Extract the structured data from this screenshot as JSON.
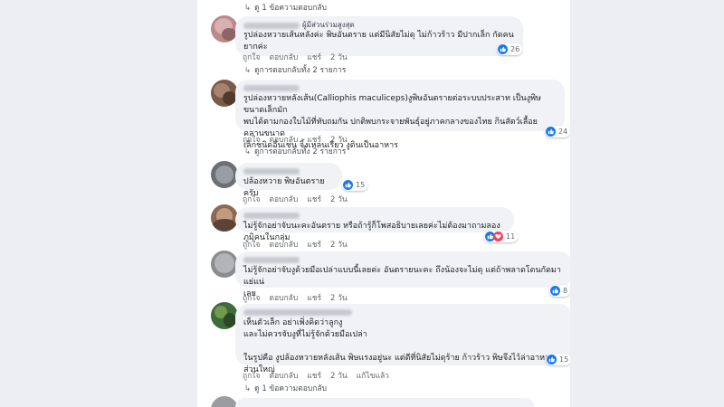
{
  "top_reply": {
    "text": "ดู 1 ข้อความตอบกลับ"
  },
  "comments": [
    {
      "badge": "ผู้มีส่วนร่วมสูงสุด",
      "text": "รูปล่องหวายเส้นหลังค่ะ พิษอันตราย แต่มีนิสัยไม่ดุ ไม่ก้าวร้าว มีปากเล็ก กัดคนยากค่ะ",
      "actions": [
        "ถูกใจ",
        "ตอบกลับ",
        "แชร์",
        "2 วัน"
      ],
      "reactions": "26",
      "replies": "ดูการตอบกลับทั้ง 2 รายการ"
    },
    {
      "badge": "",
      "text": "รูปล่องหวายหลังเส้น(Calliophis maculiceps)งูพิษอันตรายต่อระบบประสาท เป็นงูพิษขนาดเล็กมัก\nพบได้ตามกองใบไม้ที่ทับถมกัน ปกติพบกระจายพันธุ์อยู่ภาคกลางของไทย กินสัตว์เลื้อยคลานขนาด\nเล็กชนิดอื่นเช่น จิ้งเหลนเรียว งูดินเป็นอาหาร",
      "actions": [
        "ถูกใจ",
        "ตอบกลับ",
        "แชร์",
        "2 วัน"
      ],
      "reactions": "24",
      "replies": "ดูการตอบกลับทั้ง 2 รายการ"
    },
    {
      "badge": "",
      "text": "ปล้องหวาย พิษอันตรายครับ",
      "actions": [
        "ถูกใจ",
        "ตอบกลับ",
        "แชร์",
        "2 วัน"
      ],
      "reactions": "15"
    },
    {
      "badge": "",
      "text": "ไม่รู้จักอย่าจับนะคะอันตราย หรือถ้ารู้ก็โพสอธิบายเลยค่ะไม่ต้องมาถามลองภูมิคนในกลุ่ม",
      "actions": [
        "ถูกใจ",
        "ตอบกลับ",
        "แชร์",
        "2 วัน"
      ],
      "reactions": "11"
    },
    {
      "badge": "",
      "text": "ไม่รู้จักอย่าจับงูด้วยมือเปล่าแบบนี้เลยค่ะ อันตรายนะคะ ถึงน้องจะไม่ดุ แต่ถ้าพลาดโดนกัดมาแย่แน่\nเลย",
      "actions": [
        "ถูกใจ",
        "ตอบกลับ",
        "แชร์",
        "2 วัน"
      ],
      "reactions": "8"
    },
    {
      "badge": "",
      "text": "เห็นตัวเล็ก อย่าเพิ่งคิดว่าลูกงู\nและไม่ควรจับงูที่ไม่รู้จักด้วยมือเปล่า\n\nในรูปคือ งูปล้องหวายหลังเส้น พิษแรงอยู่นะ แต่ดีที่นิสัยไม่ดุร้าย ก้าวร้าว พิษจึงไว้ล่าอาหาร\nส่วนใหญ่",
      "actions": [
        "ถูกใจ",
        "ตอบกลับ",
        "แชร์",
        "2 วัน",
        "แก้ไขแล้ว"
      ],
      "reactions": "15",
      "replies": "ดู 1 ข้อความตอบกลับ"
    }
  ],
  "colors": {
    "like": "#1877f2",
    "love": "#f33e58",
    "bubble": "#f0f2f5"
  }
}
